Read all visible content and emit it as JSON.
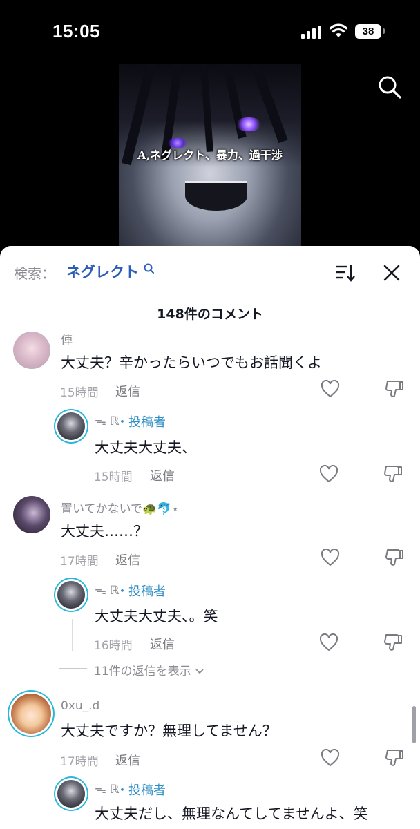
{
  "status_bar": {
    "time": "15:05",
    "battery": "38"
  },
  "video": {
    "caption": "A,ネグレクト、暴力、過干渉"
  },
  "sheet": {
    "search_label": "検索：",
    "search_term": "ネグレクト",
    "comment_count": "148件のコメント",
    "reply_label": "返信",
    "poster_suffix": "・投稿者",
    "view_more": "11件の返信を表示"
  },
  "comments": [
    {
      "name": "俥",
      "text": "大丈夫？辛かったらいつでもお話聞くよ",
      "time": "15時間"
    },
    {
      "name": "ᯓ ℝ",
      "poster": true,
      "text": "大丈夫大丈夫、",
      "time": "15時間"
    },
    {
      "name": "置いてかないで🐢🐬⋆",
      "text": "大丈夫……？",
      "time": "17時間"
    },
    {
      "name": "ᯓ ℝ",
      "poster": true,
      "text": "大丈夫大丈夫、。笑",
      "time": "16時間"
    },
    {
      "name": "0xu_.d",
      "text": "大丈夫ですか？無理してません？",
      "time": "17時間"
    },
    {
      "name": "ᯓ ℝ",
      "poster": true,
      "text": "大丈夫だし、無理なんてしてませんよ、笑",
      "time": ""
    }
  ],
  "icons": {
    "search": "search-icon",
    "sort": "sort-icon",
    "close": "close-icon",
    "heart": "heart-icon",
    "dislike": "dislike-icon",
    "chevron": "chevron-down-icon"
  },
  "colors": {
    "accent_link": "#2b5db8",
    "poster": "#2b8ec4",
    "text_primary": "#161823",
    "text_secondary": "#8a8b91"
  }
}
